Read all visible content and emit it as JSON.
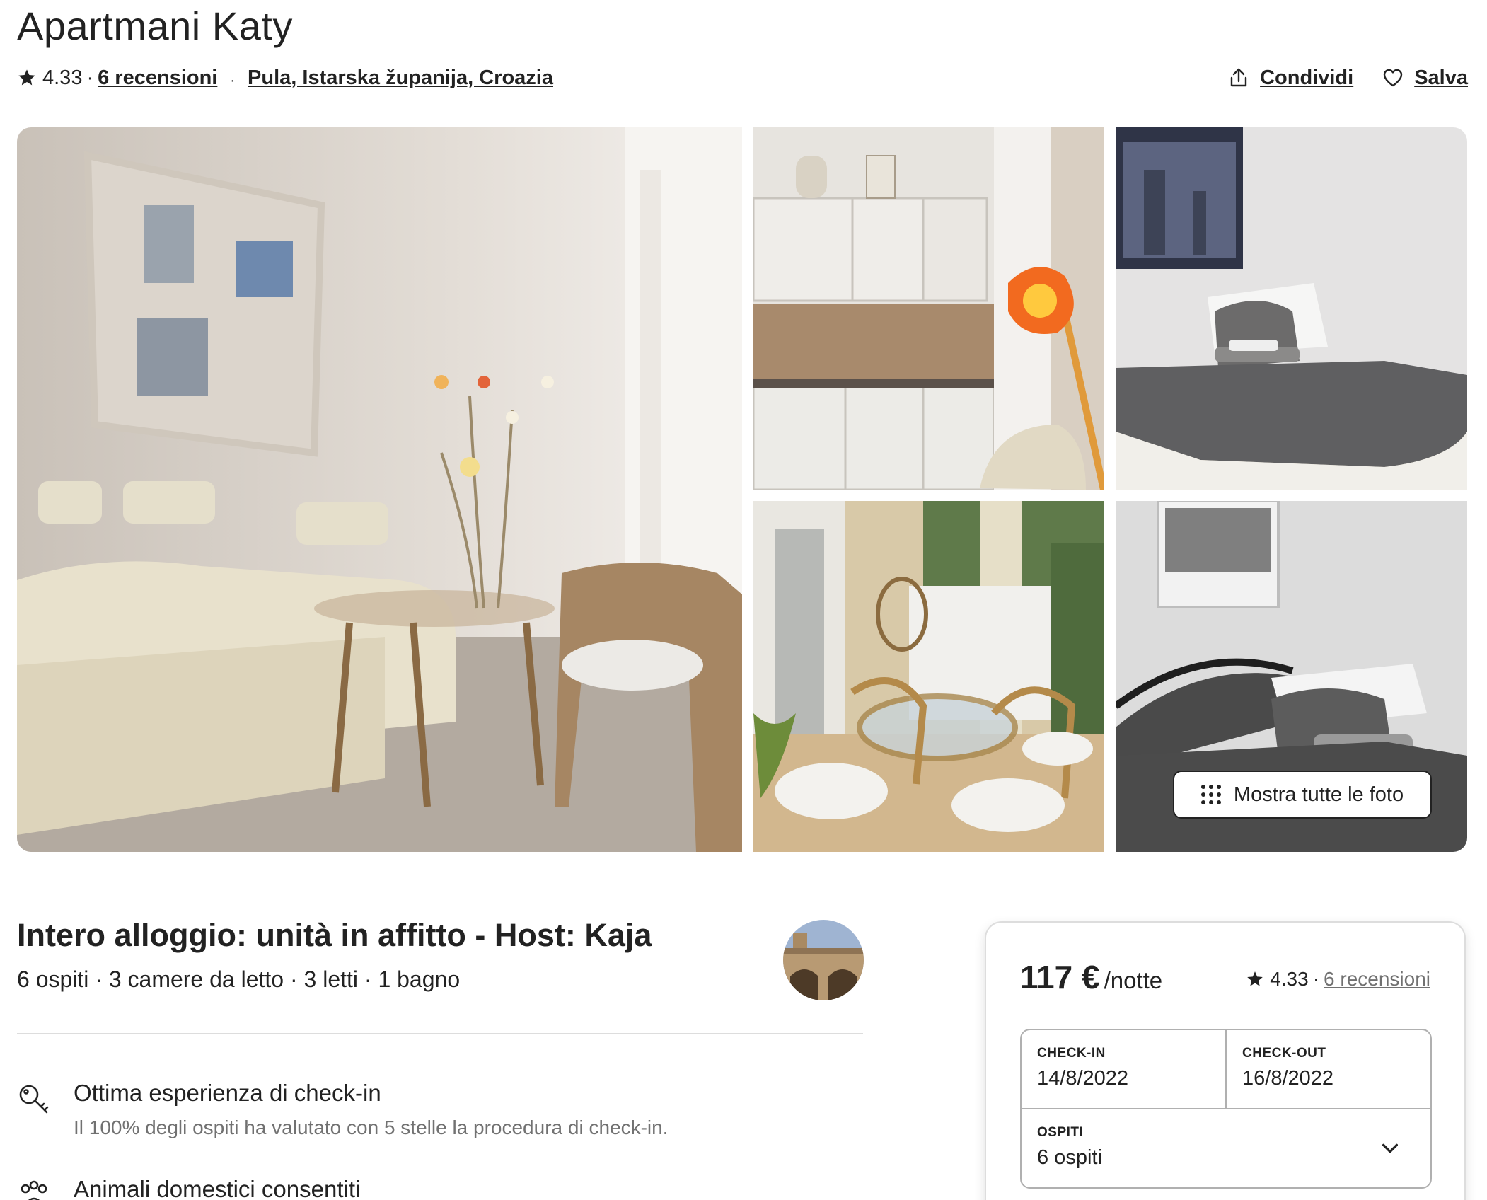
{
  "listing": {
    "title": "Apartmani Katy",
    "rating": "4.33",
    "reviews_link": "6 recensioni",
    "location": "Pula, Istarska županija, Croazia",
    "share_label": "Condividi",
    "save_label": "Salva"
  },
  "gallery": {
    "show_all_label": "Mostra tutte le foto",
    "photos": [
      "living-room",
      "kitchen",
      "bedroom",
      "terrace",
      "bedroom-2"
    ]
  },
  "details": {
    "heading": "Intero alloggio: unità in affitto - Host: Kaja",
    "summary": "6 ospiti · 3 camere da letto · 3 letti · 1 bagno",
    "features": [
      {
        "icon": "key-icon",
        "title": "Ottima esperienza di check-in",
        "desc": "Il 100% degli ospiti ha valutato con 5 stelle la procedura di check-in."
      },
      {
        "icon": "paw-icon",
        "title": "Animali domestici consentiti",
        "desc": ""
      }
    ]
  },
  "booking": {
    "price": "117 €",
    "per_night": "/notte",
    "rating": "4.33",
    "reviews_link": "6 recensioni",
    "checkin_label": "CHECK-IN",
    "checkin_value": "14/8/2022",
    "checkout_label": "CHECK-OUT",
    "checkout_value": "16/8/2022",
    "guests_label": "OSPITI",
    "guests_value": "6 ospiti"
  },
  "colors": {
    "text": "#222222",
    "muted": "#717171",
    "border": "#dddddd"
  }
}
